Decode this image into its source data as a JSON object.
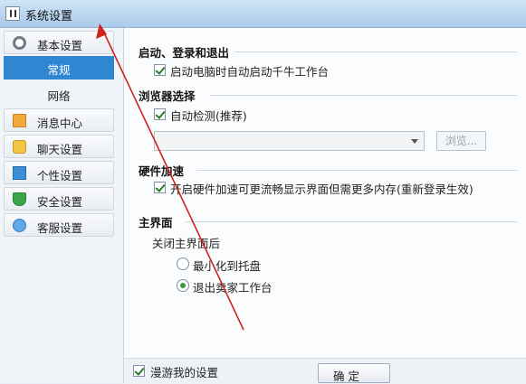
{
  "window": {
    "title": "系统设置"
  },
  "sidebar": {
    "items": [
      {
        "label": "基本设置",
        "icon": "gear-icon"
      },
      {
        "label": "消息中心",
        "icon": "mail-icon"
      },
      {
        "label": "聊天设置",
        "icon": "chat-icon"
      },
      {
        "label": "个性设置",
        "icon": "person-icon"
      },
      {
        "label": "安全设置",
        "icon": "shield-icon"
      },
      {
        "label": "客服设置",
        "icon": "service-icon"
      }
    ],
    "subitems": [
      {
        "label": "常规",
        "active": true
      },
      {
        "label": "网络",
        "active": false
      }
    ]
  },
  "sections": {
    "startup": {
      "title": "启动、登录和退出",
      "autostart_label": "启动电脑时自动启动千牛工作台",
      "autostart_checked": true
    },
    "browser": {
      "title": "浏览器选择",
      "autodetect_label": "自动检测(推荐)",
      "autodetect_checked": true,
      "browse_button": "浏览..."
    },
    "hardware": {
      "title": "硬件加速",
      "accel_label": "开启硬件加速可更流畅显示界面但需更多内存(重新登录生效)",
      "accel_checked": true
    },
    "main_ui": {
      "title": "主界面",
      "close_label": "关闭主界面后",
      "options": [
        {
          "label": "最小化到托盘",
          "selected": false
        },
        {
          "label": "退出卖家工作台",
          "selected": true
        }
      ]
    }
  },
  "footer": {
    "roam_label": "漫游我的设置",
    "roam_checked": true,
    "ok_button": "确 定"
  },
  "annotation": {
    "arrow_color": "#d0221c"
  }
}
